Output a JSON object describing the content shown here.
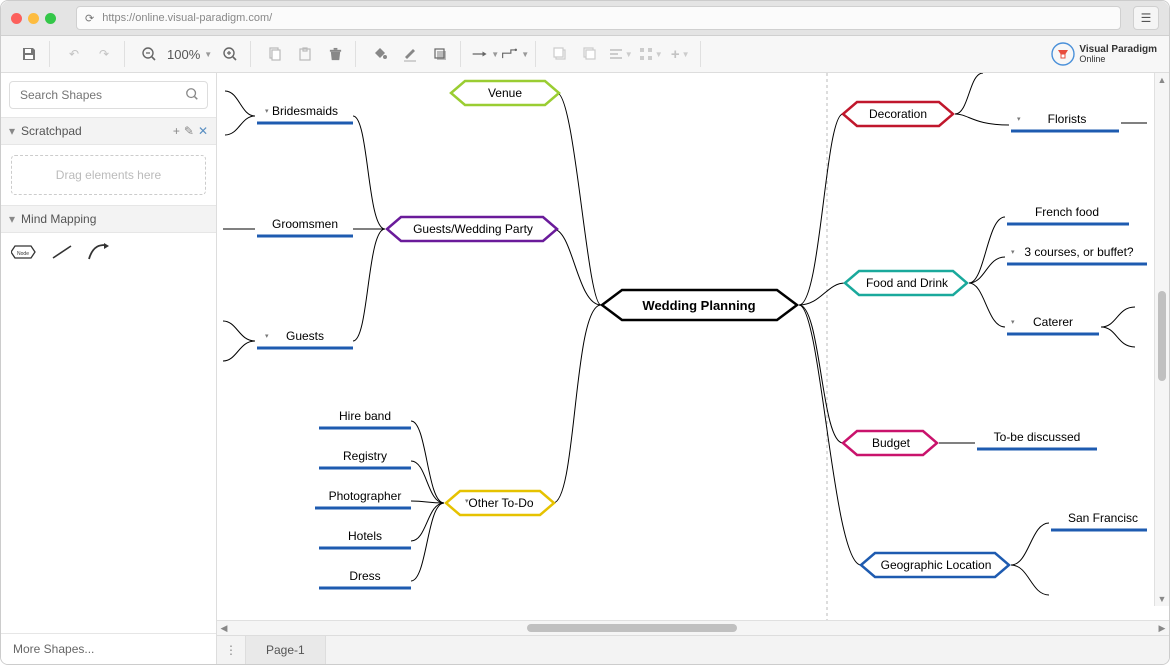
{
  "browser": {
    "url": "https://online.visual-paradigm.com/"
  },
  "toolbar": {
    "zoom": "100%",
    "logo_top": "Visual Paradigm",
    "logo_bottom": "Online"
  },
  "sidebar": {
    "search_placeholder": "Search Shapes",
    "scratchpad_label": "Scratchpad",
    "dropzone": "Drag elements here",
    "mindmap_label": "Mind Mapping",
    "more_shapes": "More Shapes..."
  },
  "page_tab": "Page-1",
  "mindmap": {
    "root": "Wedding Planning",
    "left_branches": {
      "venue": "Venue",
      "gwp": "Guests/Wedding Party",
      "gwp_children": [
        "Bridesmaids",
        "Groomsmen",
        "Guests"
      ],
      "other": "Other To-Do",
      "other_children": [
        "Hire band",
        "Registry",
        "Photographer",
        "Hotels",
        "Dress"
      ]
    },
    "right_branches": {
      "decoration": "Decoration",
      "decoration_children": [
        "Florists"
      ],
      "food": "Food and Drink",
      "food_children": [
        "French food",
        "3 courses, or buffet?",
        "Caterer"
      ],
      "budget": "Budget",
      "budget_children": [
        "To-be discussed"
      ],
      "geo": "Geographic Location",
      "geo_children": [
        "San Francisc"
      ]
    }
  }
}
